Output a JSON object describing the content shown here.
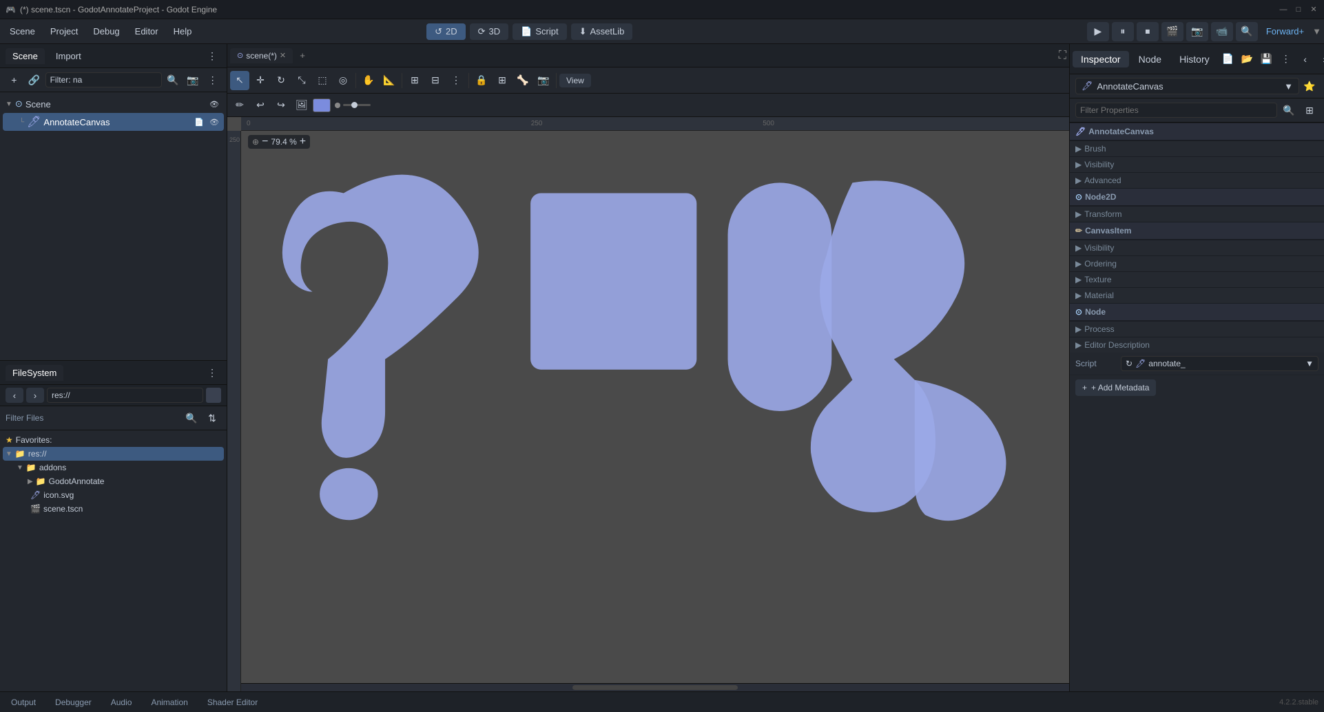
{
  "titlebar": {
    "title": "(*) scene.tscn - GodotAnnotateProject - Godot Engine",
    "controls": [
      "—",
      "□",
      "✕"
    ]
  },
  "menubar": {
    "items": [
      "Scene",
      "Project",
      "Debug",
      "Editor",
      "Help"
    ],
    "center_buttons": [
      {
        "label": "2D",
        "icon": "↺",
        "active": true
      },
      {
        "label": "3D",
        "icon": "⟳",
        "active": false
      },
      {
        "label": "Script",
        "icon": "📄",
        "active": false
      },
      {
        "label": "AssetLib",
        "icon": "⬇",
        "active": false
      }
    ],
    "play_controls": [
      "▶",
      "⏸",
      "⏹",
      "🎬",
      "📷",
      "📹",
      "🔍"
    ],
    "renderer": "Forward+"
  },
  "scene_panel": {
    "tabs": [
      "Scene",
      "Import"
    ],
    "active_tab": "Scene",
    "actions": {
      "add": "+",
      "link": "🔗",
      "filter_placeholder": "Filter: na",
      "more": "⋮"
    },
    "tree": [
      {
        "label": "Scene",
        "icon": "⊙",
        "level": 0,
        "type": "root"
      },
      {
        "label": "AnnotateCanvas",
        "icon": "🖊",
        "level": 1,
        "type": "node",
        "selected": true
      }
    ]
  },
  "filesystem_panel": {
    "title": "FileSystem",
    "nav": {
      "back": "‹",
      "forward": "›",
      "path": "res://"
    },
    "filter_label": "Filter Files",
    "favorites_label": "Favorites:",
    "tree": [
      {
        "label": "res://",
        "icon": "📁",
        "level": 0,
        "selected": true,
        "expanded": true
      },
      {
        "label": "addons",
        "icon": "📁",
        "level": 1,
        "expanded": false
      },
      {
        "label": "GodotAnnotate",
        "icon": "📁",
        "level": 2,
        "expanded": false
      },
      {
        "label": "icon.svg",
        "icon": "🖊",
        "level": 1
      },
      {
        "label": "scene.tscn",
        "icon": "🎬",
        "level": 1
      }
    ]
  },
  "viewport": {
    "tab_label": "scene(*)",
    "zoom": "79.4 %",
    "ruler_marks": [
      "0",
      "250",
      "500"
    ],
    "toolbar_buttons": [
      "cursor",
      "move",
      "rotate",
      "scale",
      "pan",
      "select",
      "grid",
      "more",
      "lock",
      "group",
      "bone",
      "camera",
      "more2"
    ],
    "sub_buttons": [
      "pencil",
      "undo_redo",
      "image",
      "color",
      "slider"
    ]
  },
  "inspector": {
    "tabs": [
      "Inspector",
      "Node",
      "History"
    ],
    "active_tab": "Inspector",
    "node_name": "AnnotateCanvas",
    "node_icon": "🖊",
    "filter_placeholder": "Filter Properties",
    "sections": [
      {
        "name": "AnnotateCanvas",
        "icon": "🖊",
        "groups": [
          {
            "name": "Brush",
            "items": []
          },
          {
            "name": "Visibility",
            "items": []
          },
          {
            "name": "Advanced",
            "items": []
          }
        ]
      },
      {
        "name": "Node2D",
        "icon": "⊙",
        "groups": [
          {
            "name": "Transform",
            "items": []
          }
        ]
      },
      {
        "name": "CanvasItem",
        "icon": "✏",
        "groups": [
          {
            "name": "Visibility",
            "items": []
          },
          {
            "name": "Ordering",
            "items": []
          },
          {
            "name": "Texture",
            "items": []
          },
          {
            "name": "Material",
            "items": []
          }
        ]
      },
      {
        "name": "Node",
        "icon": "⊙",
        "groups": [
          {
            "name": "Process",
            "items": []
          },
          {
            "name": "Editor Description",
            "items": []
          }
        ]
      }
    ],
    "script": {
      "label": "Script",
      "value": "annotate_",
      "icon": "↻"
    },
    "add_metadata_label": "+ Add Metadata"
  },
  "bottom_bar": {
    "tabs": [
      "Output",
      "Debugger",
      "Audio",
      "Animation",
      "Shader Editor"
    ],
    "version": "4.2.2.stable"
  },
  "colors": {
    "accent": "#7b8cde",
    "selected": "#3d5a80",
    "background": "#4a4a4a",
    "shape_fill": "#9ba8e8"
  }
}
